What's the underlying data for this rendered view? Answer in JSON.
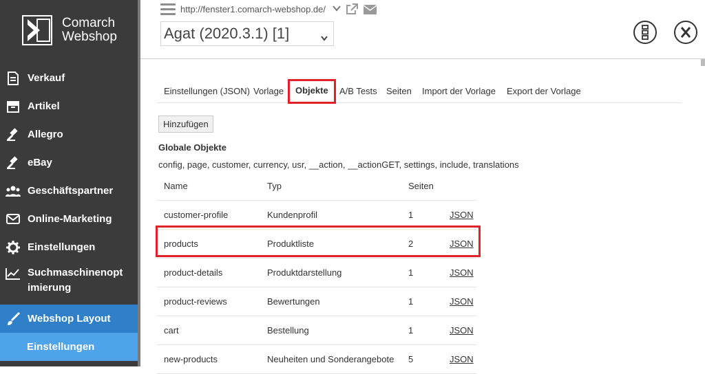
{
  "brand": {
    "line1": "Comarch",
    "line2": "Webshop"
  },
  "sidebar": {
    "items": [
      {
        "label": "Verkauf",
        "icon": "document-icon"
      },
      {
        "label": "Artikel",
        "icon": "box-icon"
      },
      {
        "label": "Allegro",
        "icon": "gavel-icon"
      },
      {
        "label": "eBay",
        "icon": "gavel-icon"
      },
      {
        "label": "Geschäftspartner",
        "icon": "users-icon"
      },
      {
        "label": "Online-Marketing",
        "icon": "envelope-icon"
      },
      {
        "label": "Einstellungen",
        "icon": "gear-icon"
      },
      {
        "label_line1": "Suchmaschinenopt",
        "label_line2": "imierung",
        "icon": "chart-icon"
      },
      {
        "label": "Webshop Layout",
        "icon": "brush-icon"
      },
      {
        "label": "Einstellungen"
      }
    ]
  },
  "topbar": {
    "url": "http://fenster1.comarch-webshop.de/",
    "version": "Agat (2020.3.1) [1]"
  },
  "tabs": [
    "Einstellungen (JSON)",
    "Vorlage",
    "Objekte",
    "A/B Tests",
    "Seiten",
    "Import der Vorlage",
    "Export der Vorlage"
  ],
  "add_button": "Hinzufügen",
  "globals": {
    "title": "Globale Objekte",
    "list": "config, page, customer, currency, usr, __action, __actionGET, settings, include, translations"
  },
  "table": {
    "headers": [
      "Name",
      "Typ",
      "Seiten"
    ],
    "rows": [
      {
        "name": "customer-profile",
        "type": "Kundenprofil",
        "pages": "1",
        "link": "JSON"
      },
      {
        "name": "products",
        "type": "Produktliste",
        "pages": "2",
        "link": "JSON"
      },
      {
        "name": "product-details",
        "type": "Produktdarstellung",
        "pages": "1",
        "link": "JSON"
      },
      {
        "name": "product-reviews",
        "type": "Bewertungen",
        "pages": "1",
        "link": "JSON"
      },
      {
        "name": "cart",
        "type": "Bestellung",
        "pages": "1",
        "link": "JSON"
      },
      {
        "name": "new-products",
        "type": "Neuheiten und Sonderangebote",
        "pages": "5",
        "link": "JSON"
      }
    ]
  },
  "colors": {
    "sidebar_bg": "#3b3b3b",
    "active_bg": "#2f80c8",
    "subactive_bg": "#4fa3e8",
    "highlight": "#e0202a"
  }
}
